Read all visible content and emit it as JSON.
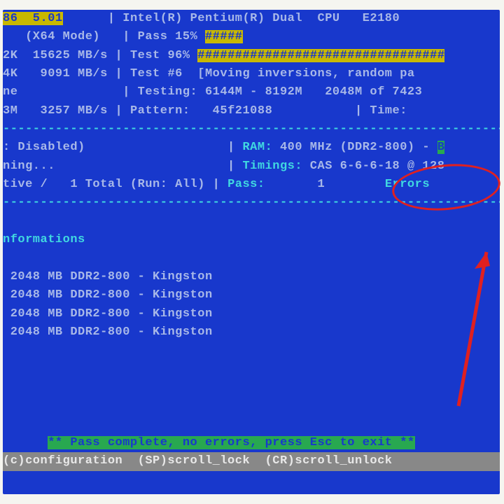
{
  "header": {
    "version": "86  5.01",
    "cpu": "Intel(R) Pentium(R) Dual  CPU   E2180",
    "mode": "(X64 Mode)",
    "pass_label": "Pass",
    "pass_pct": "15%",
    "pass_bar": "#####",
    "l2_cache": "2K  15625 MB/s",
    "test_label": "Test",
    "test_pct": "96%",
    "test_bar": "#################################",
    "l3_cache": "4K   9091 MB/s",
    "test_name": "Test #6  [Moving inversions, random pa",
    "ne_line": "ne",
    "testing_label": "Testing:",
    "testing_range": "6144M - 8192M   2048M of 7423",
    "mem_line": "3M   3257 MB/s",
    "pattern_label": "Pattern:",
    "pattern_val": "45f21088",
    "time_label": "Time:"
  },
  "status": {
    "smp": ": Disabled)",
    "ram_label": "RAM:",
    "ram_val": "400 MHz (DDR2-800)",
    "ram_tail": "B",
    "ning": "ning...",
    "timings_label": "Timings:",
    "timings_val": "CAS 6-6-6-18 @ 128",
    "tive": "tive /   1 Total (Run: All)",
    "pass_summary_label": "Pass:",
    "pass_summary_val": "1",
    "errors_label": "Errors"
  },
  "dimm": {
    "header": "nformations",
    "slots": [
      "2048 MB DDR2-800 - Kingston",
      "2048 MB DDR2-800 - Kingston",
      "2048 MB DDR2-800 - Kingston",
      "2048 MB DDR2-800 - Kingston"
    ]
  },
  "footer": {
    "complete": "** Pass complete, no errors, press Esc to exit **",
    "hints": "(c)configuration  (SP)scroll_lock  (CR)scroll_unlock"
  },
  "dividers": {
    "dash": "----------------------------------------------------------------------------"
  }
}
